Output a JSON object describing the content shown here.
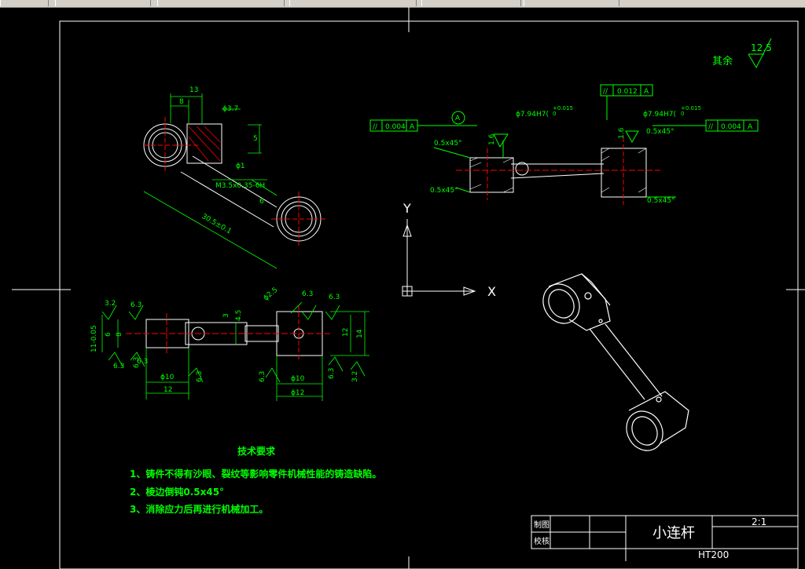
{
  "roughness": {
    "label": "其余",
    "value": "12.5"
  },
  "view_top": {
    "dims": [
      "13",
      "8",
      "ϕ3.7",
      "5",
      "ϕ1",
      "M3.5x0.35-6H",
      "6",
      "30.5±0.1"
    ]
  },
  "view_section": {
    "tolerances": [
      {
        "symbol": "//",
        "value": "0.004",
        "datum": "A"
      },
      {
        "symbol": "//",
        "value": "0.012",
        "datum": "A"
      },
      {
        "symbol": "//",
        "value": "0.004",
        "datum": "A"
      }
    ],
    "datum_marker": "A",
    "bore_left": "ϕ7.94H7(",
    "bore_right": "ϕ7.94H7(",
    "tol_upper": "+0.015",
    "tol_lower": "0",
    "chamfers": [
      "0.5x45°",
      "0.5x45°",
      "0.5x45°",
      "0.5x45°"
    ],
    "roughness": [
      "1.6",
      "1.6"
    ]
  },
  "view_front": {
    "dims": [
      "3.2",
      "6.3",
      "8",
      "6",
      "11-0.05",
      "6.3",
      "6.3",
      "ϕ10",
      "12",
      "3",
      "4.5",
      "ϕ2.5",
      "6.3",
      "6.3",
      "12",
      "14",
      "6.3",
      "ϕ10",
      "ϕ12",
      "6.3",
      "3.2",
      "6.3",
      "6.3"
    ]
  },
  "axes": {
    "y": "Y",
    "x": "X"
  },
  "tech_requirements": {
    "title": "技术要求",
    "items": [
      "1、铸件不得有沙眼、裂纹等影响零件机械性能的铸造缺陷。",
      "2、棱边倒钝0.5x45°",
      "3、消除应力后再进行机械加工。"
    ]
  },
  "title_block": {
    "drawn": "制图",
    "checked": "校核",
    "name": "小连杆",
    "scale": "2:1",
    "material": "HT200"
  }
}
